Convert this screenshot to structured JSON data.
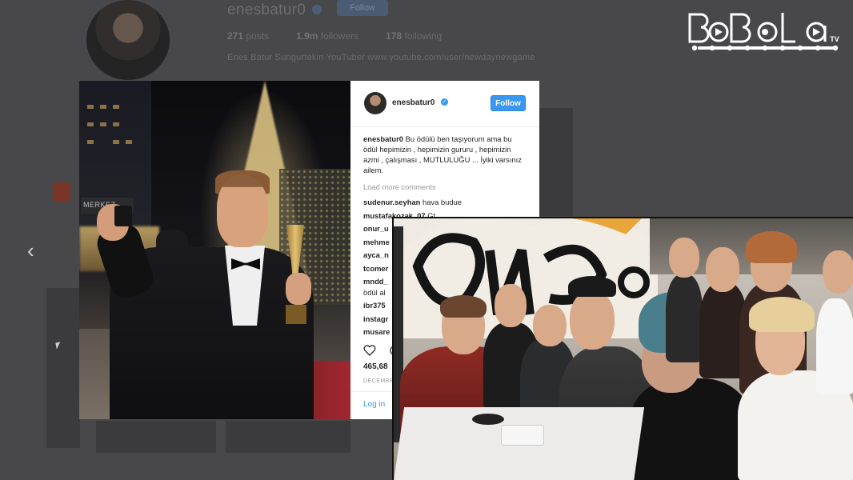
{
  "background_profile": {
    "username": "enesbatur0",
    "follow_label": "Follow",
    "stats": [
      {
        "value": "271",
        "label": "posts"
      },
      {
        "value": "1.9m",
        "label": "followers"
      },
      {
        "value": "178",
        "label": "following"
      }
    ],
    "bio": "Enes Batur Sungurtekin YouTuber www.youtube.com/user/newdaynewgame",
    "nav_prev_glyph": "‹"
  },
  "logo": {
    "text": "BaBaLa",
    "suffix": "TV",
    "color": "#ffffff"
  },
  "post": {
    "username": "enesbatur0",
    "follow_label": "Follow",
    "caption_user": "enesbatur0",
    "caption_text": "Bu ödülü ben taşıyorum ama bu ödül hepimizin , hepimizin gururu , hepimizin azmi , çalışması , MUTLULUĞU ... İyiki varsınız ailem.",
    "load_more": "Load more comments",
    "comments": [
      {
        "user": "sudenur.seyhan",
        "text": "hava budue"
      },
      {
        "user": "mustafakozak_07",
        "text": "Gt"
      },
      {
        "user": "onur_u",
        "text": ""
      },
      {
        "user": "mehme",
        "text": ""
      },
      {
        "user": "ayca_n",
        "text": ""
      },
      {
        "user": "tcomer",
        "text": ""
      },
      {
        "user": "mndd_",
        "text": ""
      },
      {
        "user": "",
        "text": "ödül al"
      },
      {
        "user": "ibr375",
        "text": ""
      },
      {
        "user": "instagr",
        "text": ""
      },
      {
        "user": "musare",
        "text": ""
      }
    ],
    "likes": "465,68",
    "date": "DECEMBE",
    "login_prefix": "Log in",
    "accent_color": "#3897f0"
  },
  "photos": {
    "award_sign": "MERKEZ"
  }
}
